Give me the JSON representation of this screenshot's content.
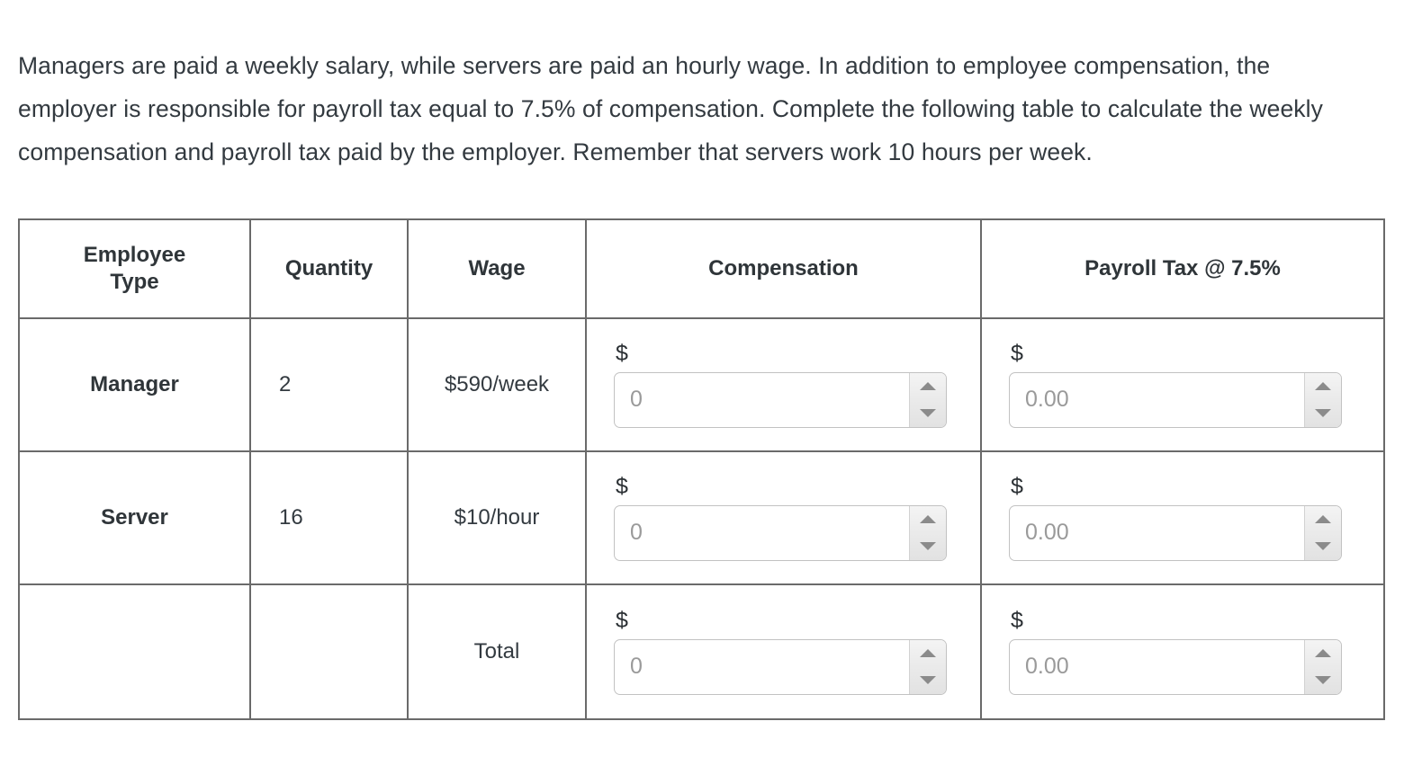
{
  "prompt": {
    "text": "Managers are paid a weekly salary, while servers are paid an hourly wage. In addition to employee compensation, the employer is responsible for payroll tax equal to 7.5% of compensation. Complete the following table to calculate the weekly compensation and payroll tax paid by the employer. Remember that servers work 10 hours per week."
  },
  "table": {
    "headers": {
      "employee_type_line1": "Employee",
      "employee_type_line2": "Type",
      "quantity": "Quantity",
      "wage": "Wage",
      "compensation": "Compensation",
      "payroll_tax": "Payroll Tax @ 7.5%"
    },
    "rows": [
      {
        "type": "Manager",
        "quantity": "2",
        "wage": "$590/week",
        "compensation": {
          "currency_symbol": "$",
          "value": "",
          "placeholder": "0"
        },
        "payroll_tax": {
          "currency_symbol": "$",
          "value": "",
          "placeholder": "0.00"
        }
      },
      {
        "type": "Server",
        "quantity": "16",
        "wage": "$10/hour",
        "compensation": {
          "currency_symbol": "$",
          "value": "",
          "placeholder": "0"
        },
        "payroll_tax": {
          "currency_symbol": "$",
          "value": "",
          "placeholder": "0.00"
        }
      },
      {
        "type": "",
        "quantity": "",
        "wage": "Total",
        "compensation": {
          "currency_symbol": "$",
          "value": "",
          "placeholder": "0"
        },
        "payroll_tax": {
          "currency_symbol": "$",
          "value": "",
          "placeholder": "0.00"
        }
      }
    ]
  },
  "icons": {
    "spin_up": "triangle-up-icon",
    "spin_down": "triangle-down-icon"
  },
  "colors": {
    "text": "#333a40",
    "heading_text": "#2f3539",
    "table_border": "#6a6a6a",
    "input_border": "#c2c2c2",
    "placeholder": "#9a9a9a",
    "spinner_arrow": "#8b8b8b",
    "background": "#ffffff"
  }
}
